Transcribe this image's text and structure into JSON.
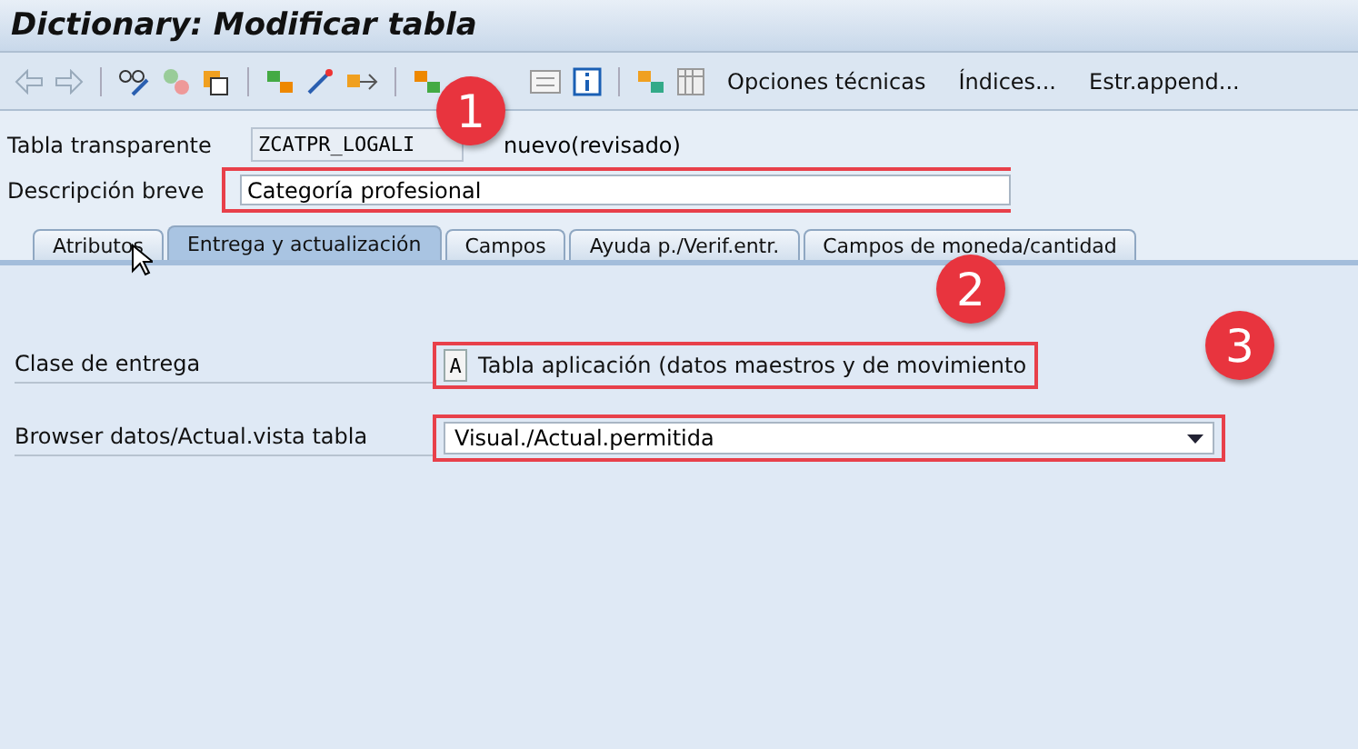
{
  "window": {
    "title": "Dictionary: Modificar tabla"
  },
  "toolbar": {
    "text_buttons": [
      "Opciones técnicas",
      "Índices...",
      "Estr.append..."
    ]
  },
  "header": {
    "table_label": "Tabla transparente",
    "table_name": "ZCATPR_LOGALI",
    "status": "nuevo(revisado)",
    "description_label": "Descripción breve",
    "description_value": "Categoría profesional"
  },
  "tabs": [
    {
      "label": "Atributos",
      "selected": false
    },
    {
      "label": "Entrega y actualización",
      "selected": true
    },
    {
      "label": "Campos",
      "selected": false
    },
    {
      "label": "Ayuda p./Verif.entr.",
      "selected": false
    },
    {
      "label": "Campos de moneda/cantidad",
      "selected": false
    }
  ],
  "panel": {
    "delivery_label": "Clase de entrega",
    "delivery_code": "A",
    "delivery_text": "Tabla aplicación (datos maestros y de movimiento",
    "browser_label": "Browser datos/Actual.vista tabla",
    "browser_value": "Visual./Actual.permitida"
  },
  "annotations": [
    "1",
    "2",
    "3"
  ]
}
